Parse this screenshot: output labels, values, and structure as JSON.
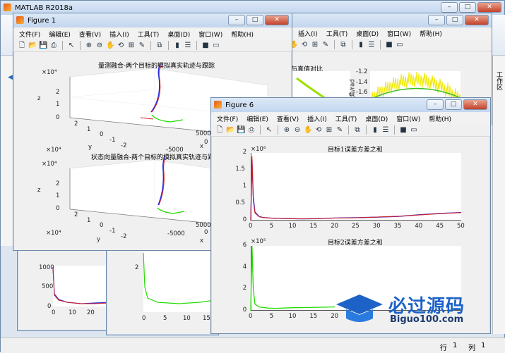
{
  "matlab": {
    "title": "MATLAB R2018a",
    "side_tab_label": "工作区",
    "status_row": "行",
    "status_row_val": "1",
    "status_col": "列",
    "status_col_val": "1"
  },
  "menus": [
    "文件(F)",
    "编辑(E)",
    "查看(V)",
    "插入(I)",
    "工具(T)",
    "桌面(D)",
    "窗口(W)",
    "帮助(H)"
  ],
  "menus_back": [
    "插入(I)",
    "工具(T)",
    "桌面(D)",
    "窗口(W)",
    "帮助(H)"
  ],
  "fig1": {
    "title": "Figure 1",
    "top": {
      "title": "量测融合-两个目标的模拟真实轨迹与跟踪",
      "z_exp": "×10⁴",
      "z_label": "z",
      "z_ticks": [
        "2",
        "1",
        "0"
      ],
      "y_exp": "×10⁴",
      "y_label": "y",
      "y_ticks": [
        "2",
        "1",
        "0",
        "-1",
        "-2"
      ],
      "x_label": "x",
      "x_ticks": [
        "-5000",
        "0",
        "5000"
      ]
    },
    "bottom": {
      "title": "状态向量融合-两个目标的模拟真实轨迹与跟踪",
      "z_exp": "×10⁴",
      "z_label": "z",
      "z_ticks": [
        "2",
        "1",
        "0"
      ],
      "y_exp": "×10⁴",
      "y_label": "y",
      "y_ticks": [
        "2",
        "1",
        "0",
        "-1",
        "-2"
      ],
      "x_label": "x",
      "x_ticks": [
        "-5000",
        "0",
        "5000"
      ]
    }
  },
  "back_fig": {
    "title_frag": "与真值对比",
    "ylabel": "角/rad",
    "yticks": [
      "-1.2",
      "-1.4",
      "-1.6"
    ]
  },
  "small_left": {
    "y_ticks": [
      "1000",
      "500",
      "0"
    ],
    "x_ticks": [
      "0",
      "10",
      "20"
    ]
  },
  "mid_back": {
    "y_ticks": [
      "2"
    ],
    "x_ticks": [
      "0",
      "5",
      "10",
      "15"
    ]
  },
  "fig6": {
    "title": "Figure 6",
    "top": {
      "title": "目标1误差方差之和",
      "exp": "×10⁶",
      "yticks": [
        "2",
        "1.5",
        "1",
        "0.5",
        "0"
      ]
    },
    "bottom": {
      "title": "目标2误差方差之和",
      "exp": "×10⁵",
      "yticks": [
        "6",
        "4",
        "2",
        "0"
      ]
    },
    "xticks": [
      "0",
      "5",
      "10",
      "15",
      "20",
      "25",
      "30",
      "35",
      "40",
      "45",
      "50"
    ],
    "xticks_b": [
      "0",
      "5",
      "10",
      "15",
      "20"
    ]
  },
  "watermark": {
    "cn": "必过源码",
    "en": "Biguo100.com"
  },
  "colors": {
    "track1": "#2b2bd8",
    "track2": "#d81b1b",
    "green": "#22dd00",
    "yellow": "#f0e800"
  },
  "chart_data": [
    {
      "type": "line",
      "title": "目标1误差方差之和",
      "x_range": [
        0,
        50
      ],
      "ylim": [
        0,
        2000000
      ],
      "series": [
        {
          "color": "#2b2bd8",
          "x": [
            0,
            0.3,
            0.6,
            1,
            2,
            3,
            5,
            8,
            12,
            16,
            20,
            25,
            30,
            35,
            40,
            45,
            50
          ],
          "y": [
            0,
            1800000,
            700000,
            250000,
            120000,
            90000,
            70000,
            60000,
            50000,
            55000,
            75000,
            85000,
            100000,
            120000,
            170000,
            210000,
            240000
          ]
        },
        {
          "color": "#d81b1b",
          "x": [
            0,
            0.3,
            0.6,
            1,
            2,
            3,
            5,
            8,
            12,
            16,
            20,
            25,
            30,
            35,
            40,
            45,
            50
          ],
          "y": [
            0,
            1900000,
            600000,
            220000,
            110000,
            85000,
            70000,
            58000,
            52000,
            58000,
            72000,
            82000,
            105000,
            125000,
            165000,
            205000,
            235000
          ]
        }
      ]
    },
    {
      "type": "line",
      "title": "目标2误差方差之和",
      "x_range": [
        0,
        20
      ],
      "ylim": [
        0,
        600000
      ],
      "series": [
        {
          "color": "#22dd00",
          "x": [
            0,
            0.3,
            0.6,
            1,
            2,
            4,
            6,
            8,
            10,
            14,
            18,
            20
          ],
          "y": [
            0,
            600000,
            200000,
            60000,
            35000,
            25000,
            22000,
            25000,
            28000,
            30000,
            33000,
            35000
          ]
        }
      ]
    }
  ]
}
